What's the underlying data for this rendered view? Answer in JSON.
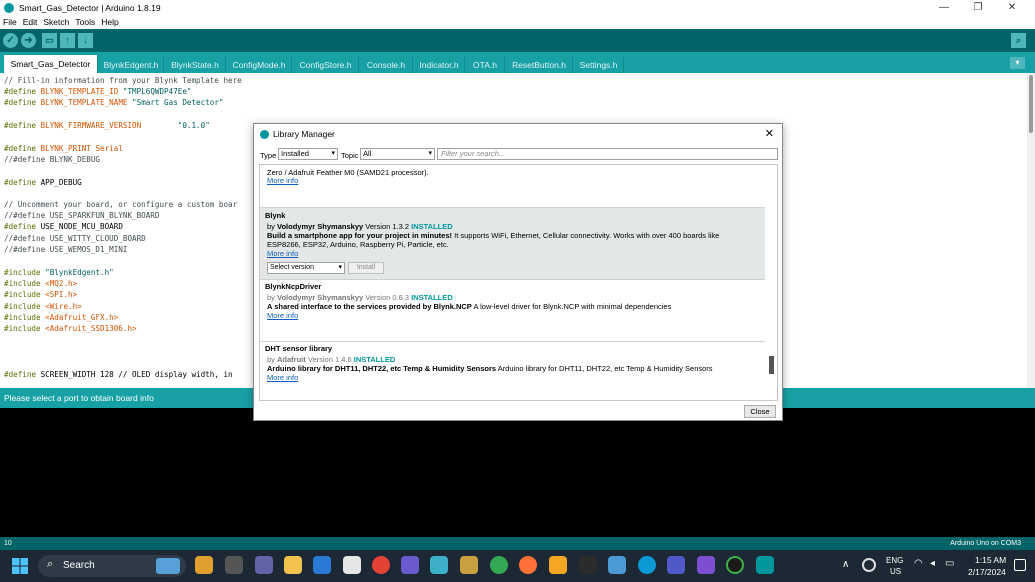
{
  "window": {
    "title": "Smart_Gas_Detector | Arduino 1.8.19",
    "controls": [
      "—",
      "❐",
      "✕"
    ]
  },
  "menu": [
    "File",
    "Edit",
    "Sketch",
    "Tools",
    "Help"
  ],
  "toolbar": {
    "verify": "✓",
    "upload": "➜",
    "new": "▭",
    "open": "↑",
    "save": "↓",
    "serial_monitor": "⌕"
  },
  "tabs": [
    "Smart_Gas_Detector",
    "BlynkEdgent.h",
    "BlynkState.h",
    "ConfigMode.h",
    "ConfigStore.h",
    "Console.h",
    "Indicator.h",
    "OTA.h",
    "ResetButton.h",
    "Settings.h"
  ],
  "tab_menu": "▾",
  "code": {
    "l1": "// Fill-in information from your Blynk Template here",
    "l2a": "#define",
    "l2b": "BLYNK_TEMPLATE_ID",
    "l2c": "\"TMPL6QWDP47Ee\"",
    "l3a": "#define",
    "l3b": "BLYNK_TEMPLATE_NAME",
    "l3c": "\"Smart Gas Detector\"",
    "l5a": "#define",
    "l5b": "BLYNK_FIRMWARE_VERSION",
    "l5c": "\"0.1.0\"",
    "l7a": "#define",
    "l7b": "BLYNK_PRINT",
    "l7c": "Serial",
    "l8": "//#define BLYNK_DEBUG",
    "l10a": "#define",
    "l10b": "APP_DEBUG",
    "l12": "// Uncomment your board, or configure a custom boar",
    "l13": "//#define USE_SPARKFUN_BLYNK_BOARD",
    "l14a": "#define",
    "l14b": "USE_NODE_MCU_BOARD",
    "l15": "//#define USE_WITTY_CLOUD_BOARD",
    "l16": "//#define USE_WEMOS_D1_MINI",
    "l18a": "#include",
    "l18b": "\"BlynkEdgent.h\"",
    "l19a": "#include",
    "l19b": "<MQ2.h>",
    "l20a": "#include",
    "l20b": "<SPI.h>",
    "l21a": "#include",
    "l21b": "<Wire.h>",
    "l22a": "#include",
    "l22b": "<Adafruit_GFX.h>",
    "l23a": "#include",
    "l23b": "<Adafruit_SSD1306.h>",
    "l27a": "#define",
    "l27b": "SCREEN_WIDTH 128 // OLED display width, in"
  },
  "status_message": "Please select a port to obtain board info",
  "footer": {
    "line": "10",
    "board": "Arduino Uno on COM3"
  },
  "library_manager": {
    "title": "Library Manager",
    "close_x": "✕",
    "type_label": "Type",
    "type_value": "Installed",
    "topic_label": "Topic",
    "topic_value": "All",
    "search_placeholder": "Filter your search...",
    "partial_entry": {
      "desc": "Zero / Adafruit Feather M0 (SAMD21 processor).",
      "more": "More info"
    },
    "entries": [
      {
        "name": "Blynk",
        "by": "by",
        "author": "Volodymyr Shymanskyy",
        "version": "Version 1.3.2",
        "installed": "INSTALLED",
        "desc_bold": "Build a smartphone app for your project in minutes!",
        "desc": " It supports WiFi, Ethernet, Cellular connectivity. Works with over 400 boards like ESP8266, ESP32, Arduino, Raspberry Pi, Particle, etc.",
        "more": "More info",
        "select_version": "Select version",
        "install": "Install"
      },
      {
        "name": "BlynkNcpDriver",
        "by": "by",
        "author": "Volodymyr Shymanskyy",
        "version": "Version 0.6.3",
        "installed": "INSTALLED",
        "desc_bold": "A shared interface to the services provided by Blynk.NCP",
        "desc": " A low-level driver for Blynk.NCP with minimal dependencies",
        "more": "More info"
      },
      {
        "name": "DHT sensor library",
        "by": "by",
        "author": "Adafruit",
        "version": "Version 1.4.6",
        "installed": "INSTALLED",
        "desc_bold": "Arduino library for DHT11, DHT22, etc Temp & Humidity Sensors",
        "desc": " Arduino library for DHT11, DHT22, etc Temp & Humidity Sensors",
        "more": "More info"
      }
    ],
    "close_button": "Close"
  },
  "taskbar": {
    "search": "Search",
    "lang1": "ENG",
    "lang2": "US",
    "time": "1:15 AM",
    "date": "2/17/2024",
    "tray_up": "∧"
  },
  "colors": {
    "toolbar": "#006468",
    "tabs": "#17a1a5",
    "accent": "#00979c"
  }
}
